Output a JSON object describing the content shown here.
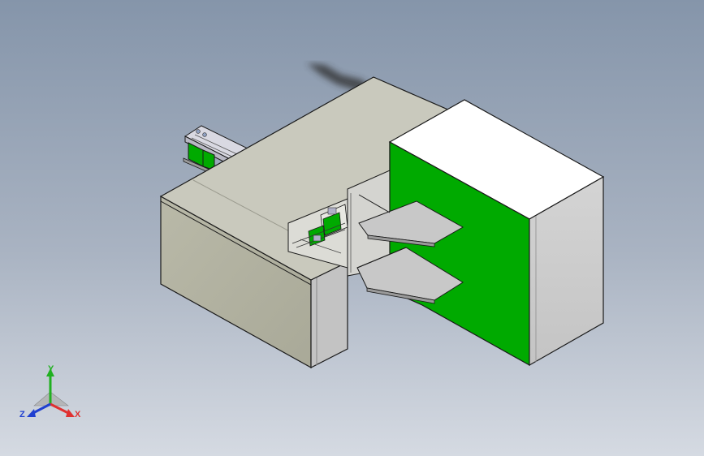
{
  "viewport": {
    "background_top": "#8595aa",
    "background_bottom": "#d5dae2"
  },
  "model": {
    "accent_green": "#00aa00",
    "body_color": "#c9c9bd",
    "top_face_color": "#ffffff",
    "edge_color": "#1a1a1a"
  },
  "triad": {
    "x_label": "X",
    "y_label": "Y",
    "z_label": "Z",
    "x_color": "#e03030",
    "y_color": "#20b020",
    "z_color": "#2040d0"
  }
}
